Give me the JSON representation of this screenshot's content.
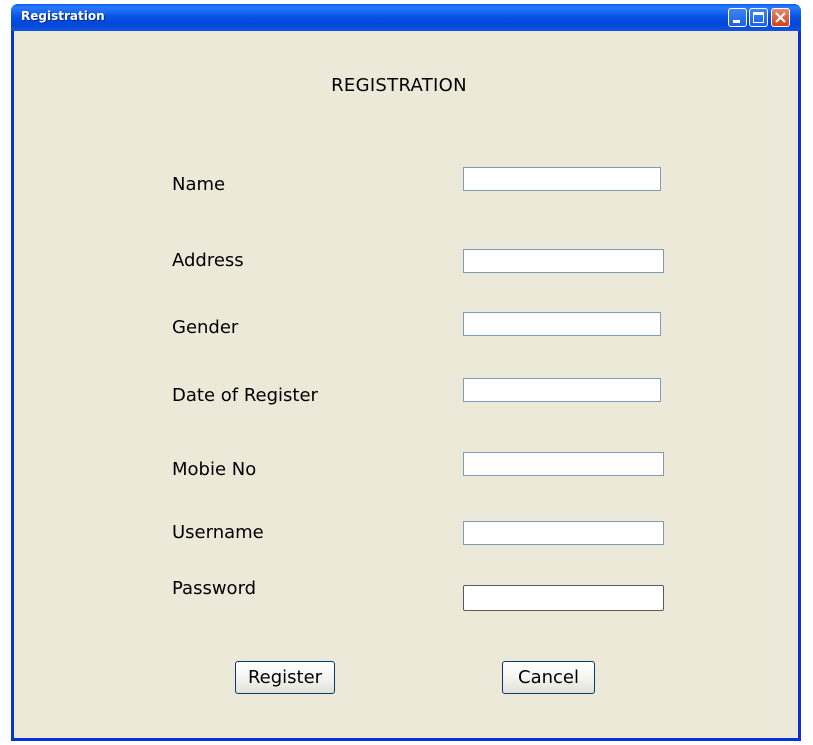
{
  "window": {
    "title": "Registration",
    "controls": [
      "minimize-icon",
      "maximize-icon",
      "close-icon"
    ]
  },
  "form": {
    "heading": "REGISTRATION",
    "fields": {
      "name": {
        "label": "Name",
        "value": ""
      },
      "address": {
        "label": "Address",
        "value": ""
      },
      "gender": {
        "label": "Gender",
        "value": ""
      },
      "date_of_register": {
        "label": "Date of Register",
        "value": ""
      },
      "mobile_no": {
        "label": "Mobie No",
        "value": ""
      },
      "username": {
        "label": "Username",
        "value": ""
      },
      "password": {
        "label": "Password",
        "value": ""
      }
    },
    "buttons": {
      "register": "Register",
      "cancel": "Cancel"
    }
  },
  "colors": {
    "titlebar": "#0a5cf5",
    "client_background": "#ece9d8",
    "field_border": "#7f9db9",
    "button_border": "#003c74"
  }
}
